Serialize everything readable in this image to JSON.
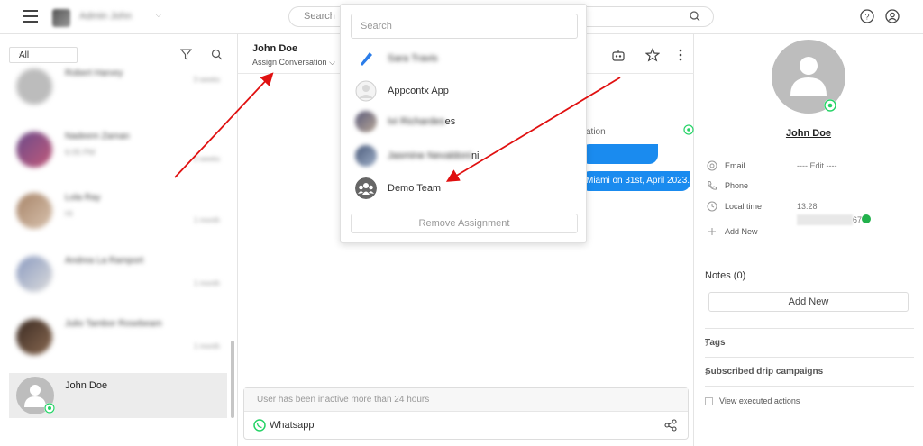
{
  "topbar": {
    "account_name": "Admin John",
    "search_placeholder": "Search"
  },
  "left": {
    "filter": "All",
    "conversations": [
      {
        "name": "Robert Harvey",
        "sub": "",
        "meta": "3 weeks"
      },
      {
        "name": "Nadeem Zaman",
        "sub": "6:05 PM",
        "meta": "3 weeks"
      },
      {
        "name": "Lola Ray",
        "sub": "Hi",
        "meta": "1 month"
      },
      {
        "name": "Andrea La Ramport",
        "sub": "",
        "meta": "1 month"
      },
      {
        "name": "Julio Tambor Rosebeam",
        "sub": "",
        "meta": "1 month"
      }
    ],
    "active_conversation": "John Doe"
  },
  "chat": {
    "name": "John Doe",
    "assign_label": "Assign Conversation",
    "message_label": "ation",
    "bubble2_text": "Miami on 31st, April 2023.",
    "inactive_notice": "User has been inactive more than 24 hours",
    "channel": "Whatsapp"
  },
  "dropdown": {
    "search_placeholder": "Search",
    "items": [
      {
        "label": "Sara Travis",
        "blurred": true
      },
      {
        "label": "Appcontx App",
        "blurred": false
      },
      {
        "label": "es",
        "blurred_prefix": "Ivi Richardes"
      },
      {
        "label": "ni",
        "blurred_prefix": "Jasmine Nevaldoni"
      },
      {
        "label": "Demo Team",
        "blurred": false
      }
    ],
    "remove_label": "Remove Assignment"
  },
  "contact": {
    "name": "John Doe",
    "email_label": "Email",
    "email_value": "---- Edit ----",
    "phone_label": "Phone",
    "phone_tail": "67",
    "localtime_label": "Local time",
    "localtime_value": "13:28",
    "add_new_label": "Add New",
    "notes_title": "Notes (0)",
    "notes_add": "Add New",
    "tags_label": "Tags",
    "drip_label": "Subscribed drip campaigns",
    "view_executed": "View executed actions"
  },
  "colors": {
    "bubble_blue": "#1a8bef",
    "whatsapp_green": "#25d366",
    "arrow_red": "#e01010"
  }
}
